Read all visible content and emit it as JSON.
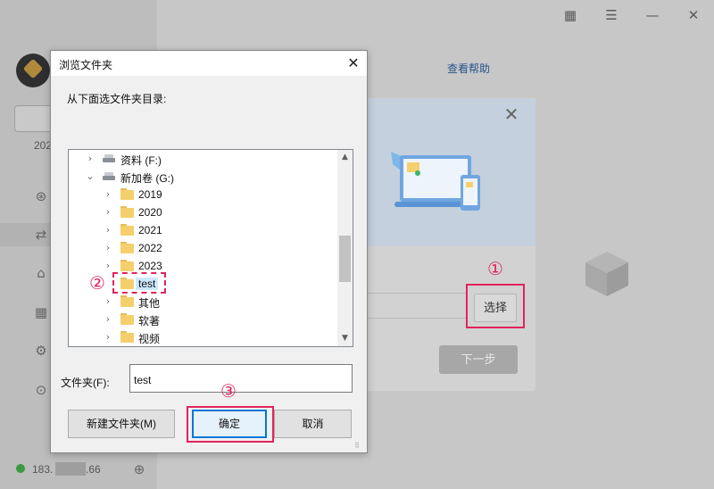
{
  "app": {
    "help_link": "查看帮助",
    "year_stub": "202",
    "status_ip_prefix": "183.",
    "status_ip_suffix": ".66"
  },
  "icons": {
    "qr": "▦",
    "menu": "☰",
    "minimize": "—",
    "close": "✕",
    "wheel": "⊛",
    "folder_transfer": "⇄",
    "home": "⌂",
    "grid": "▦",
    "gear": "⚙",
    "compass": "⊙",
    "zoom": "⊕"
  },
  "wizard": {
    "choose_button": "选择",
    "next_button": "下一步",
    "close": "✕"
  },
  "annotations": {
    "one": "①",
    "two": "②",
    "three": "③",
    "color": "#e0245e"
  },
  "dialog": {
    "title": "浏览文件夹",
    "close": "✕",
    "prompt": "从下面选文件夹目录:",
    "tree": [
      {
        "label": "资料 (F:)",
        "type": "drive",
        "chevron": "›",
        "level": 0
      },
      {
        "label": "新加卷 (G:)",
        "type": "drive",
        "chevron": "⌄",
        "level": 0
      },
      {
        "label": "2019",
        "type": "folder",
        "chevron": "›",
        "level": 1
      },
      {
        "label": "2020",
        "type": "folder",
        "chevron": "›",
        "level": 1
      },
      {
        "label": "2021",
        "type": "folder",
        "chevron": "›",
        "level": 1
      },
      {
        "label": "2022",
        "type": "folder",
        "chevron": "›",
        "level": 1
      },
      {
        "label": "2023",
        "type": "folder",
        "chevron": "›",
        "level": 1
      },
      {
        "label": "test",
        "type": "folder",
        "chevron": "",
        "level": 1,
        "selected": true
      },
      {
        "label": "其他",
        "type": "folder",
        "chevron": "›",
        "level": 1
      },
      {
        "label": "软著",
        "type": "folder",
        "chevron": "›",
        "level": 1
      },
      {
        "label": "视频",
        "type": "folder",
        "chevron": "›",
        "level": 1
      }
    ],
    "scroll_up": "▲",
    "scroll_down": "▼",
    "folder_label": "文件夹(F):",
    "folder_value": "test",
    "new_folder_button": "新建文件夹(M)",
    "ok_button": "确定",
    "cancel_button": "取消",
    "grip": "⠿"
  }
}
